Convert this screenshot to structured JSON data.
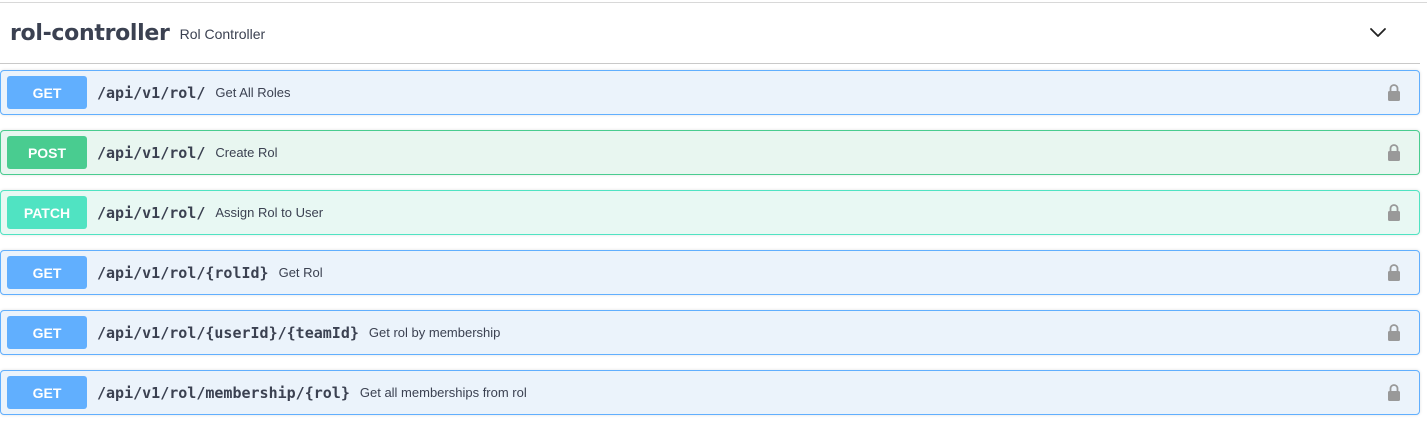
{
  "tag": {
    "name": "rol-controller",
    "description": "Rol Controller",
    "expanded": true,
    "icon": "chevron-down-icon"
  },
  "colors": {
    "get": "#61affe",
    "post": "#49cc90",
    "patch": "#50e3c2",
    "text": "#3b4151",
    "lock": "#999999"
  },
  "operations": [
    {
      "method": "GET",
      "path": "/api/v1/rol/",
      "summary": "Get All Roles"
    },
    {
      "method": "POST",
      "path": "/api/v1/rol/",
      "summary": "Create Rol"
    },
    {
      "method": "PATCH",
      "path": "/api/v1/rol/",
      "summary": "Assign Rol to User"
    },
    {
      "method": "GET",
      "path": "/api/v1/rol/{rolId}",
      "summary": "Get Rol"
    },
    {
      "method": "GET",
      "path": "/api/v1/rol/{userId}/{teamId}",
      "summary": "Get rol by membership"
    },
    {
      "method": "GET",
      "path": "/api/v1/rol/membership/{rol}",
      "summary": "Get all memberships from rol"
    }
  ]
}
